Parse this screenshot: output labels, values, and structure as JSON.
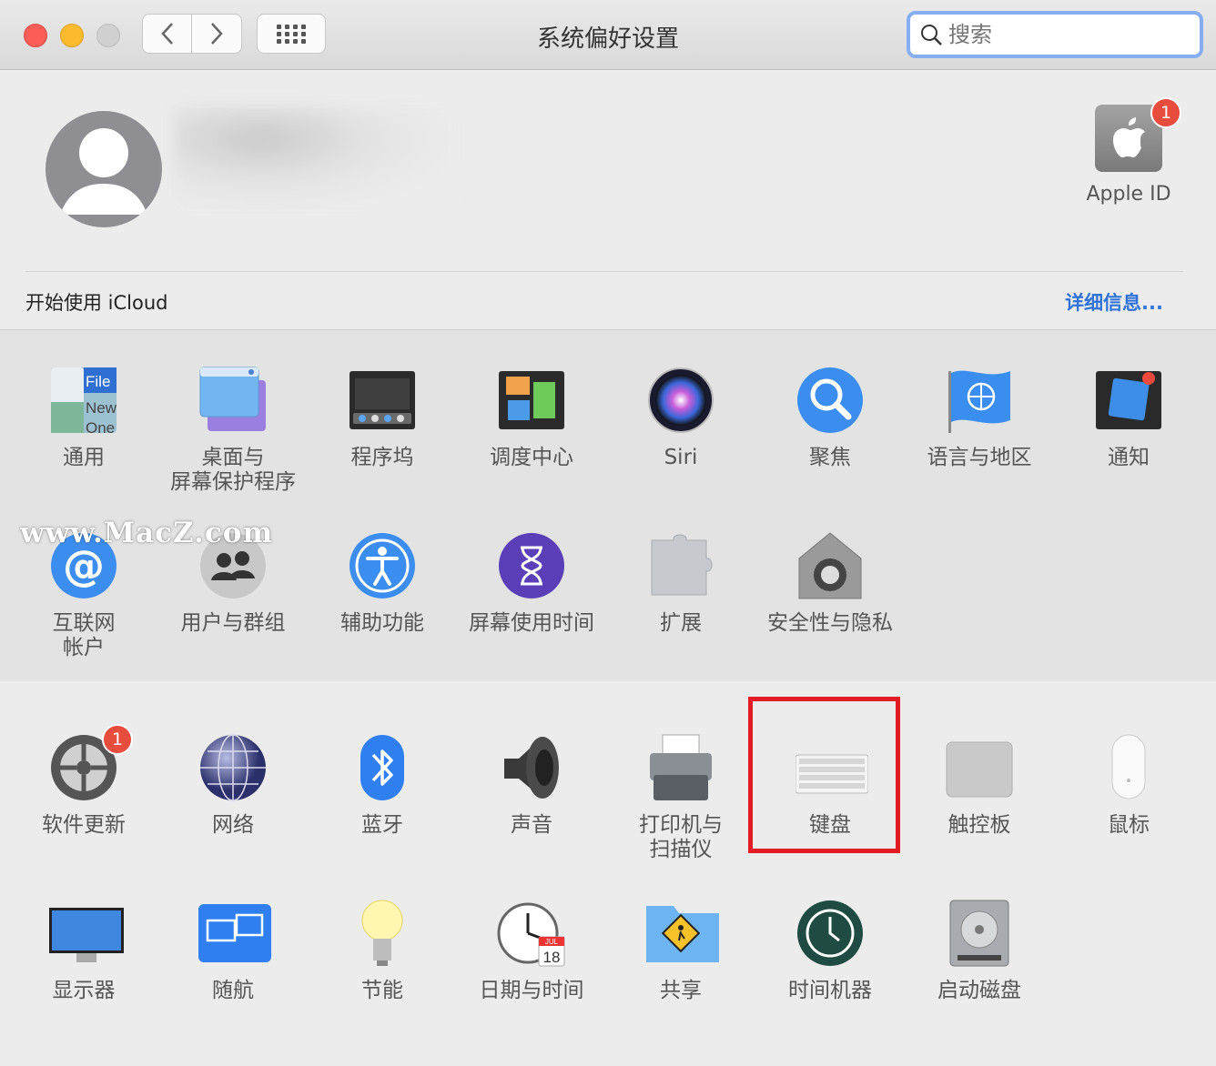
{
  "window": {
    "title": "系统偏好设置",
    "search_placeholder": "搜索"
  },
  "account": {
    "apple_id_label": "Apple ID",
    "apple_id_badge": "1",
    "icloud_prompt": "开始使用 iCloud",
    "details_link": "详细信息..."
  },
  "row1": [
    {
      "label": "通用",
      "icon": "general-icon"
    },
    {
      "label": "桌面与\n屏幕保护程序",
      "icon": "desktop-screensaver-icon"
    },
    {
      "label": "程序坞",
      "icon": "dock-icon"
    },
    {
      "label": "调度中心",
      "icon": "mission-control-icon"
    },
    {
      "label": "Siri",
      "icon": "siri-icon"
    },
    {
      "label": "聚焦",
      "icon": "spotlight-icon"
    },
    {
      "label": "语言与地区",
      "icon": "language-region-icon"
    },
    {
      "label": "通知",
      "icon": "notifications-icon"
    }
  ],
  "row2": [
    {
      "label": "互联网\n帐户",
      "icon": "internet-accounts-icon"
    },
    {
      "label": "用户与群组",
      "icon": "users-groups-icon"
    },
    {
      "label": "辅助功能",
      "icon": "accessibility-icon"
    },
    {
      "label": "屏幕使用时间",
      "icon": "screen-time-icon"
    },
    {
      "label": "扩展",
      "icon": "extensions-icon"
    },
    {
      "label": "安全性与隐私",
      "icon": "security-privacy-icon"
    }
  ],
  "row3": [
    {
      "label": "软件更新",
      "icon": "software-update-icon",
      "badge": "1"
    },
    {
      "label": "网络",
      "icon": "network-icon"
    },
    {
      "label": "蓝牙",
      "icon": "bluetooth-icon"
    },
    {
      "label": "声音",
      "icon": "sound-icon"
    },
    {
      "label": "打印机与\n扫描仪",
      "icon": "printers-scanners-icon"
    },
    {
      "label": "键盘",
      "icon": "keyboard-icon",
      "highlighted": true
    },
    {
      "label": "触控板",
      "icon": "trackpad-icon"
    },
    {
      "label": "鼠标",
      "icon": "mouse-icon"
    }
  ],
  "row4": [
    {
      "label": "显示器",
      "icon": "displays-icon"
    },
    {
      "label": "随航",
      "icon": "sidecar-icon"
    },
    {
      "label": "节能",
      "icon": "energy-saver-icon"
    },
    {
      "label": "日期与时间",
      "icon": "date-time-icon"
    },
    {
      "label": "共享",
      "icon": "sharing-icon"
    },
    {
      "label": "时间机器",
      "icon": "time-machine-icon"
    },
    {
      "label": "启动磁盘",
      "icon": "startup-disk-icon"
    }
  ],
  "general_icon_text": [
    "File",
    "New",
    "One"
  ],
  "date_icon": {
    "month": "JUL",
    "day": "18"
  },
  "watermark": "www.MacZ.com",
  "colors": {
    "accent": "#2f72d8",
    "highlight": "#e31b23",
    "badge": "#e74c3c"
  }
}
